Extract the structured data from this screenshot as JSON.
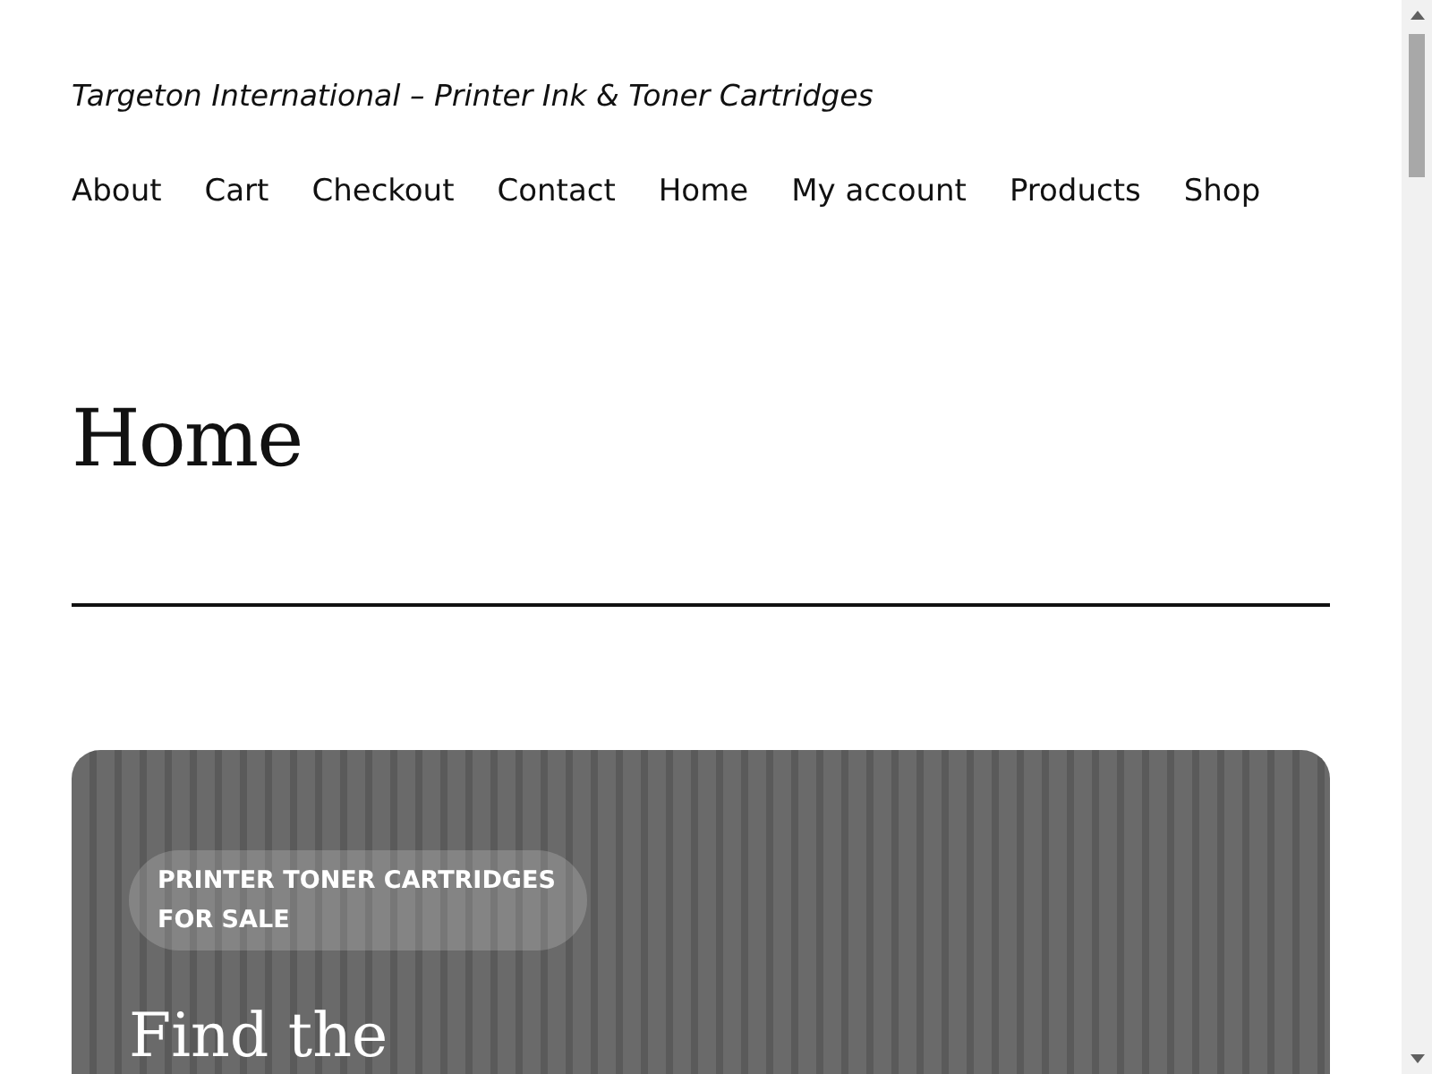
{
  "site": {
    "tagline": "Targeton International – Printer Ink & Toner Cartridges"
  },
  "nav": [
    "About",
    "Cart",
    "Checkout",
    "Contact",
    "Home",
    "My account",
    "Products",
    "Shop"
  ],
  "page": {
    "title": "Home"
  },
  "hero": {
    "badge": "PRINTER TONER CARTRIDGES FOR SALE",
    "heading": "Find the"
  }
}
